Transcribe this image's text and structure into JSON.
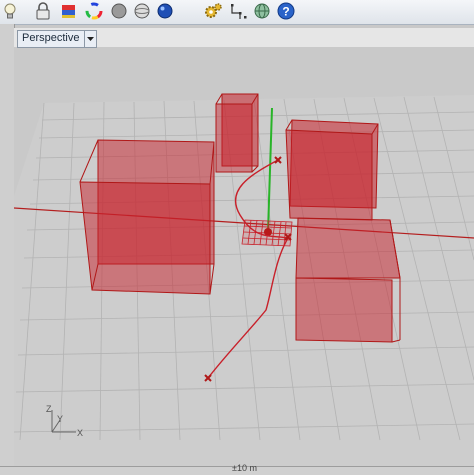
{
  "toolbar": {
    "icons": [
      "lightbulb-icon",
      "lock-icon",
      "layer-color-icon",
      "color-wheel-icon",
      "sphere-render-icon",
      "sphere-ghosted-icon",
      "sphere-rendered-icon",
      "gear-tools-icon",
      "snap-points-icon",
      "globe-icon",
      "help-icon"
    ]
  },
  "viewport": {
    "tab_label": "Perspective",
    "world_axes": {
      "z": "Z",
      "y": "Y",
      "x": "X"
    }
  },
  "status": {
    "text": "±10 m"
  },
  "colors": {
    "object_red": "#c8202a",
    "z_axis_green": "#28b428",
    "x_axis_red": "#b41e1e",
    "grid": "#b0b0b0"
  }
}
